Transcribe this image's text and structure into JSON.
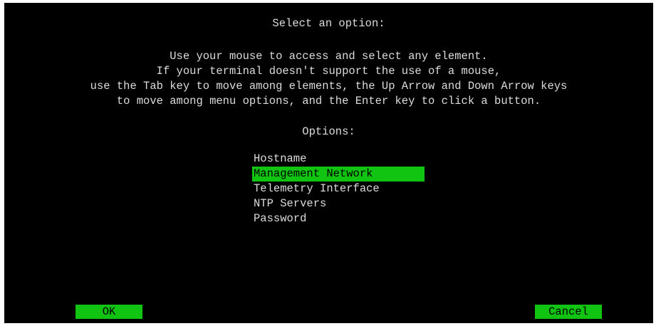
{
  "dialog": {
    "title": "Select an option:",
    "instructions": [
      "Use your mouse to access and select any element.",
      "If your terminal doesn't support the use of a mouse,",
      "use the Tab key to move among elements, the Up Arrow and Down Arrow keys",
      "to move among menu options, and the Enter key to click a button."
    ],
    "options_heading": "Options:"
  },
  "menu": {
    "items": [
      {
        "label": "Hostname",
        "selected": false
      },
      {
        "label": "Management Network",
        "selected": true
      },
      {
        "label": "Telemetry Interface",
        "selected": false
      },
      {
        "label": "NTP Servers",
        "selected": false
      },
      {
        "label": "Password",
        "selected": false
      }
    ]
  },
  "buttons": {
    "ok_label": "OK",
    "cancel_label": "Cancel"
  },
  "colors": {
    "background": "#000000",
    "text": "#dcdcdc",
    "highlight": "#11c411",
    "highlight_text": "#000000"
  }
}
